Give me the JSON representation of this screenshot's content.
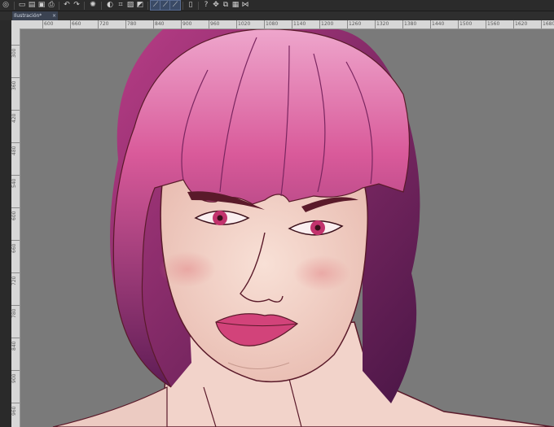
{
  "toolbar": {
    "items": [
      {
        "name": "app-menu-icon",
        "glyph": "◎"
      },
      {
        "name": "new-file-icon",
        "glyph": "▭"
      },
      {
        "name": "open-file-icon",
        "glyph": "▤"
      },
      {
        "name": "save-icon",
        "glyph": "▣"
      },
      {
        "name": "print-icon",
        "glyph": "⎙"
      },
      {
        "name": "undo-icon",
        "glyph": "↶"
      },
      {
        "name": "redo-icon",
        "glyph": "↷"
      },
      {
        "name": "loading-spinner-icon",
        "glyph": "✺"
      },
      {
        "name": "fill-icon",
        "glyph": "◐"
      },
      {
        "name": "crop-icon",
        "glyph": "⌗"
      },
      {
        "name": "gradient-icon",
        "glyph": "▨"
      },
      {
        "name": "tone-icon",
        "glyph": "◩"
      },
      {
        "name": "stroke-tool-1-icon",
        "glyph": "⟋"
      },
      {
        "name": "stroke-tool-2-icon",
        "glyph": "⟋"
      },
      {
        "name": "stroke-tool-3-icon",
        "glyph": "⟋"
      },
      {
        "name": "device-icon",
        "glyph": "▯"
      },
      {
        "name": "help-icon",
        "glyph": "?"
      },
      {
        "name": "transform-icon",
        "glyph": "✥"
      },
      {
        "name": "layers-icon",
        "glyph": "⧉"
      },
      {
        "name": "image-icon",
        "glyph": "▦"
      },
      {
        "name": "flip-icon",
        "glyph": "⋈"
      }
    ]
  },
  "tab": {
    "title": "Ilustración*",
    "close": "×"
  },
  "ruler": {
    "h_labels": [
      "600",
      "660",
      "720",
      "780",
      "840",
      "900",
      "960",
      "1020",
      "1080",
      "1140",
      "1200",
      "1260",
      "1320",
      "1380",
      "1440",
      "1500",
      "1560",
      "1620",
      "1680"
    ],
    "v_labels": [
      "300",
      "360",
      "420",
      "480",
      "540",
      "600",
      "660",
      "720",
      "780",
      "840",
      "900",
      "960"
    ]
  },
  "colors": {
    "toolbar_bg": "#2b2b2b",
    "tab_bg": "#3b4352",
    "canvas_bg": "#7a7a7a",
    "hair_light": "#e88ab8",
    "hair_dark": "#6e1f5e",
    "skin": "#f0cdc3",
    "lips": "#d2437a",
    "line": "#5a1a2a"
  }
}
